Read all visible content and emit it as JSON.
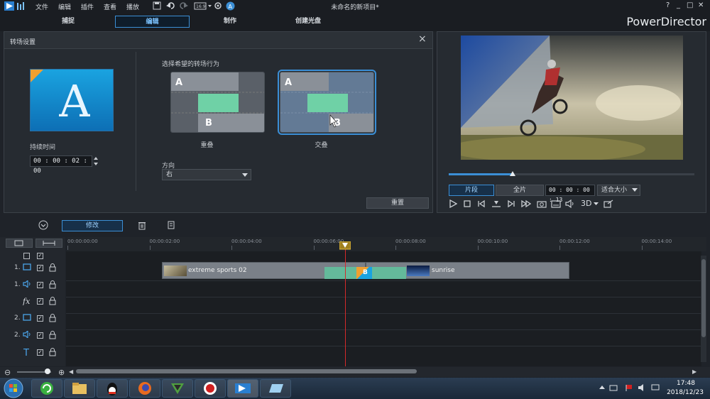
{
  "menu": [
    "文件",
    "编辑",
    "插件",
    "查看",
    "播放"
  ],
  "window_title": "未命名的新项目*",
  "window_controls": [
    "?",
    "_",
    "□",
    "✕"
  ],
  "tabs": [
    "捕捉",
    "编辑",
    "制作",
    "创建光盘"
  ],
  "brand": "PowerDirector",
  "panel": {
    "title": "转场设置",
    "duration_label": "持续时间",
    "duration_value": "00 : 00 : 02 : 00",
    "behavior_label": "选择希望的转场行为",
    "options": [
      {
        "name": "重叠",
        "selected": false
      },
      {
        "name": "交叠",
        "selected": true
      }
    ],
    "direction_label": "方向",
    "direction_value": "右",
    "reset_label": "重置"
  },
  "preview": {
    "mode_clip": "片段",
    "mode_full": "全片",
    "timecode": "00 : 00 : 00 : 13",
    "zoom": "适合大小",
    "three_d": "3D",
    "scrub_fraction": 0.26
  },
  "timeline": {
    "modify_label": "修改",
    "ruler_ticks": [
      "00:00:00:00",
      "00:00:02:00",
      "00:00:04:00",
      "00:00:06:00",
      "00:00:08:00",
      "00:00:10:00",
      "00:00:12:00",
      "00:00:14:00"
    ],
    "clips": [
      {
        "name": "extreme sports 02"
      },
      {
        "name": "sunrise"
      }
    ],
    "tracks": [
      {
        "num": "1.",
        "type": "video"
      },
      {
        "num": "1.",
        "type": "audio"
      },
      {
        "num": "",
        "type": "fx"
      },
      {
        "num": "2.",
        "type": "video"
      },
      {
        "num": "2.",
        "type": "audio"
      },
      {
        "num": "",
        "type": "title"
      }
    ]
  },
  "taskbar": {
    "time": "17:48",
    "date": "2018/12/23"
  },
  "colors": {
    "accent": "#3b8fd6",
    "clip": "#7a8088",
    "transition": "#5fc8a0",
    "playhead": "#d42a2a"
  }
}
